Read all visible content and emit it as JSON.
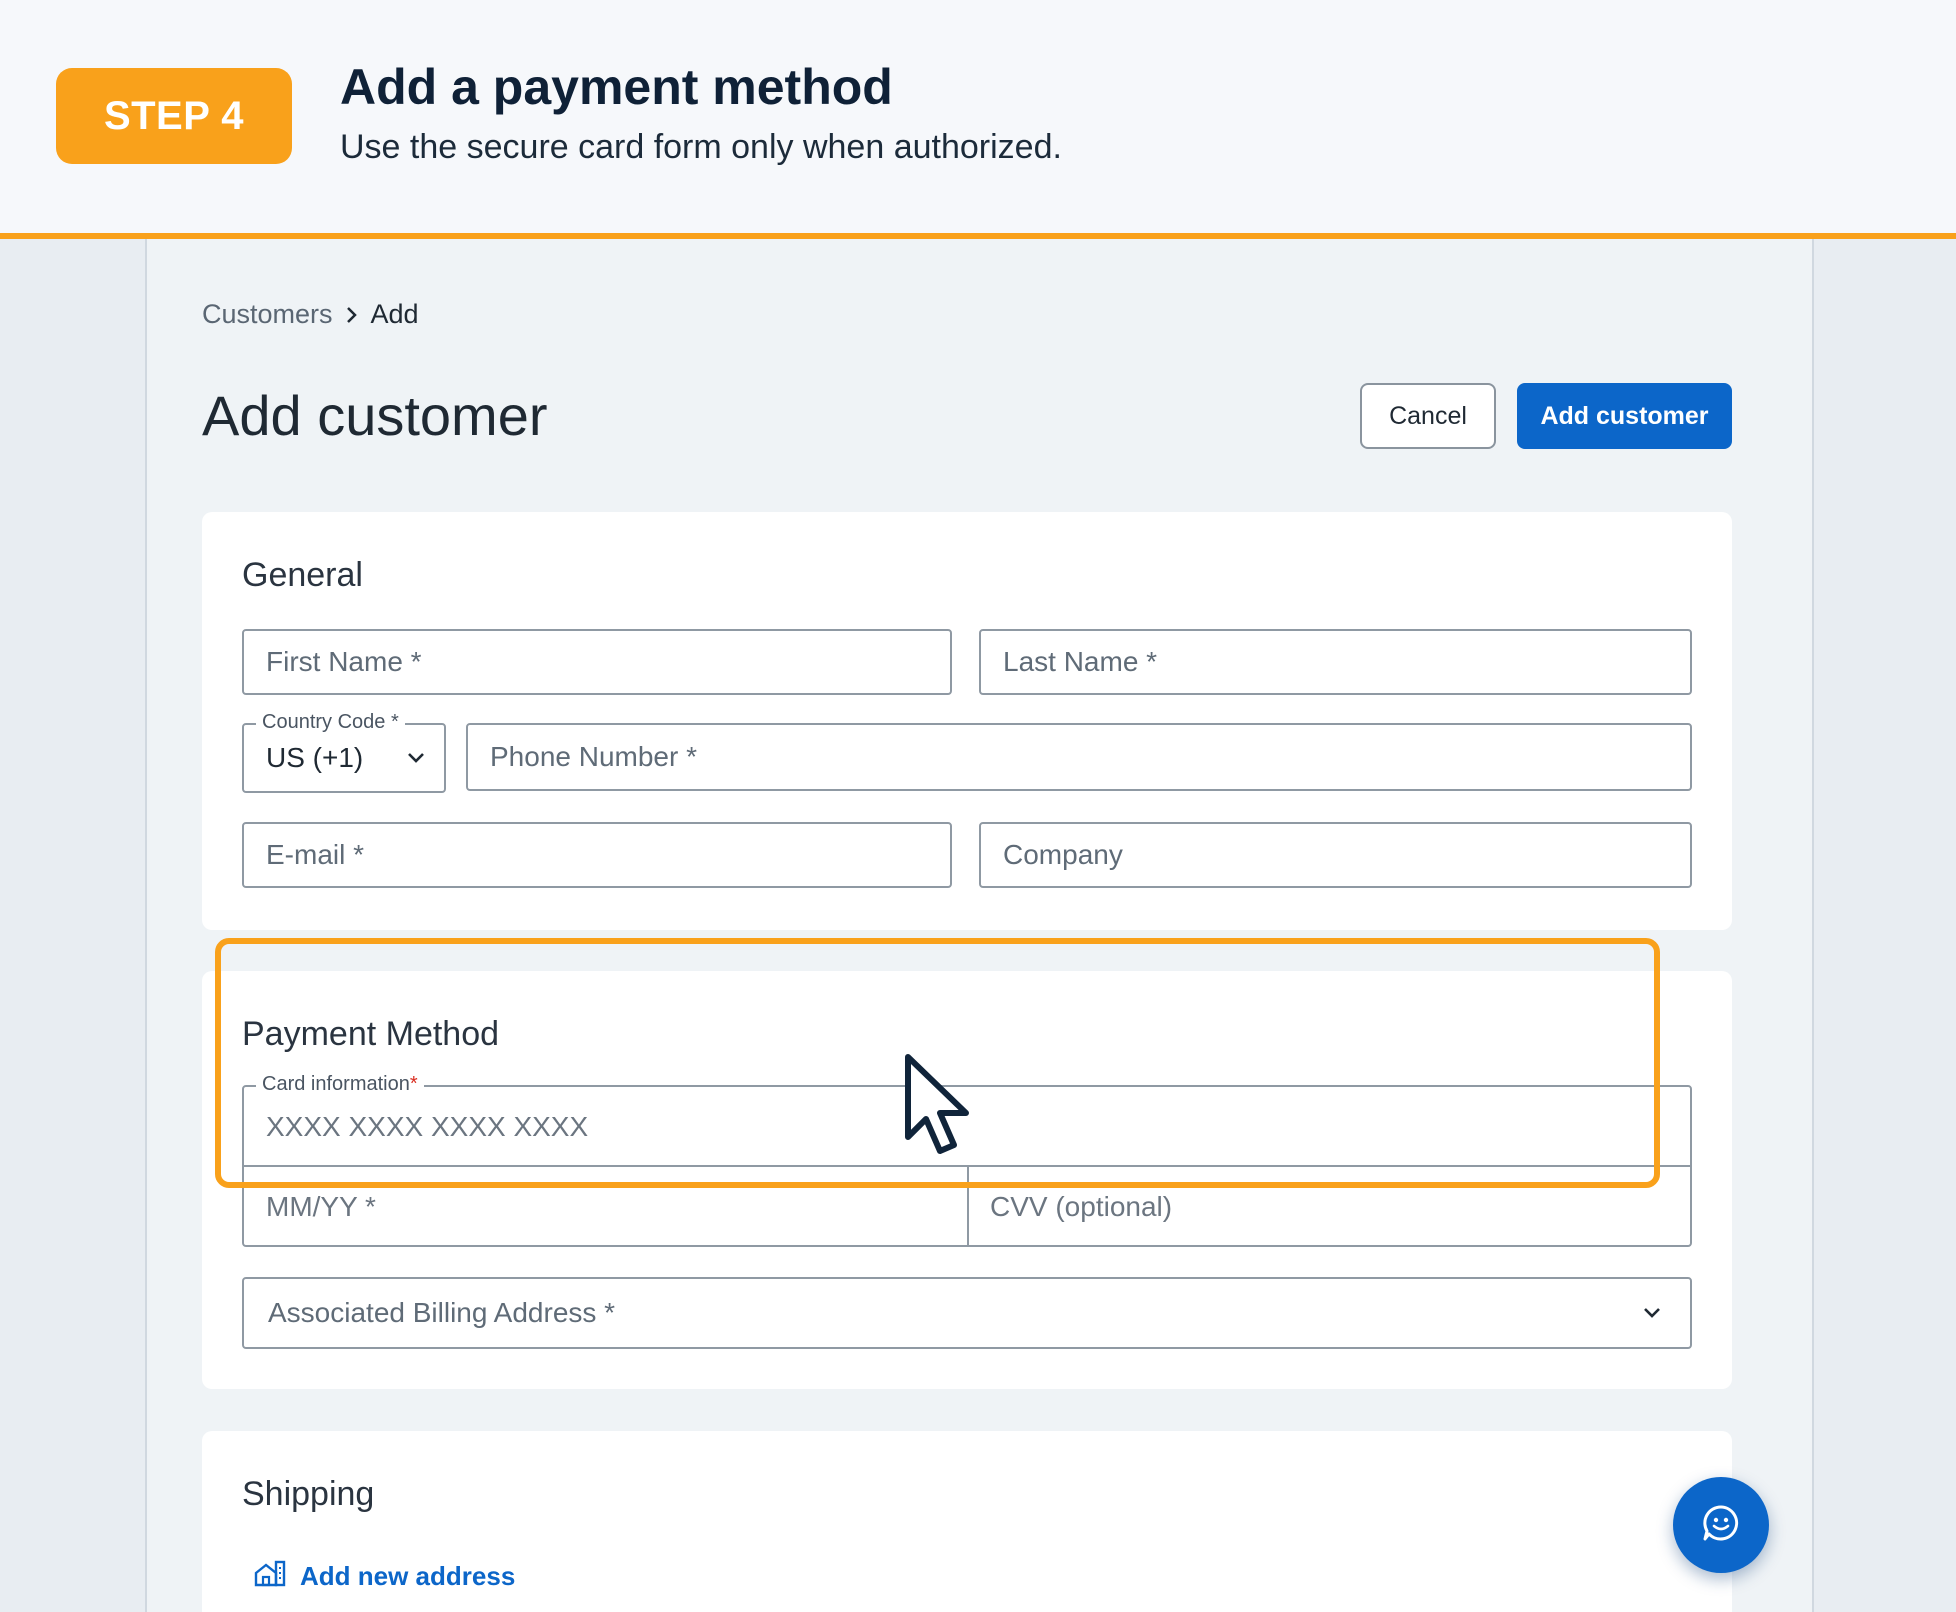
{
  "banner": {
    "step_label": "STEP 4",
    "title": "Add a payment method",
    "subtitle": "Use the secure card form only when authorized."
  },
  "breadcrumb": {
    "parent": "Customers",
    "current": "Add"
  },
  "page": {
    "title": "Add customer",
    "cancel_label": "Cancel",
    "submit_label": "Add customer"
  },
  "general": {
    "title": "General",
    "first_name_placeholder": "First Name *",
    "last_name_placeholder": "Last Name *",
    "country_code_label": "Country Code *",
    "country_code_value": "US (+1)",
    "phone_placeholder": "Phone Number *",
    "email_placeholder": "E-mail *",
    "company_placeholder": "Company"
  },
  "payment": {
    "title": "Payment Method",
    "card_info_label": "Card information",
    "required_mark": "*",
    "card_number_placeholder": "XXXX XXXX XXXX XXXX",
    "expiry_placeholder": "MM/YY *",
    "cvv_placeholder": "CVV (optional)",
    "billing_address_placeholder": "Associated Billing Address *"
  },
  "shipping": {
    "title": "Shipping",
    "add_address_label": "Add new address"
  },
  "colors": {
    "accent": "#f9a11b",
    "primary": "#0c66c9",
    "required": "#d92d20"
  },
  "icons": {
    "breadcrumb_separator": "chevron-right-icon",
    "dropdown": "chevron-down-icon",
    "add_address": "building-icon",
    "chat": "chat-icon",
    "pointer": "mouse-pointer-icon"
  }
}
